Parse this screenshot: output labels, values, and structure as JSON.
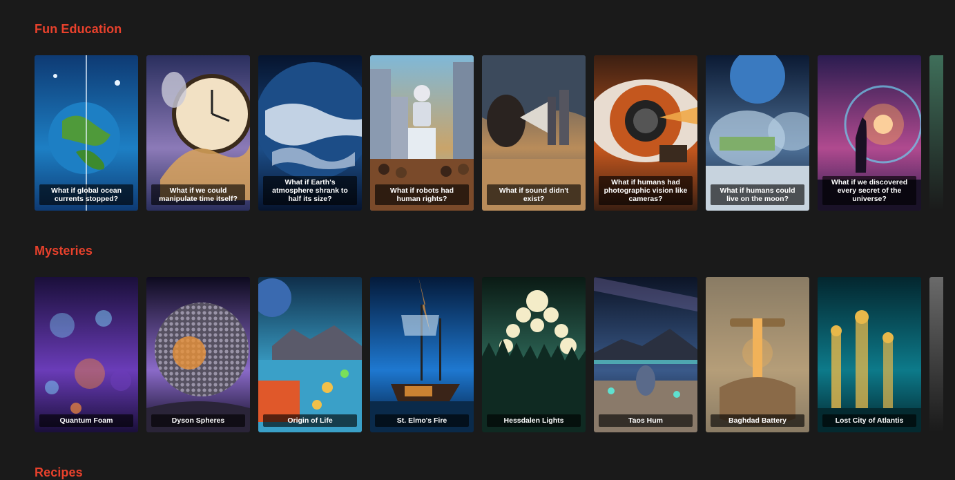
{
  "sections": [
    {
      "title": "Fun Education",
      "cards": [
        {
          "caption": "What if global ocean currents stopped?",
          "art": "earth-ocean",
          "colors": [
            "#0e3a73",
            "#1d7fc4",
            "#6ac6f0",
            "#e8f4ff"
          ]
        },
        {
          "caption": "What if we could manipulate time itself?",
          "art": "clock",
          "colors": [
            "#2a2f5e",
            "#8c7ab8",
            "#d9a35a",
            "#f2e1c4"
          ]
        },
        {
          "caption": "What if Earth's atmosphere shrank to half its size?",
          "art": "earth-clouds",
          "colors": [
            "#06142e",
            "#1c4d87",
            "#5e9bd3",
            "#dfeaf5"
          ]
        },
        {
          "caption": "What if robots had human rights?",
          "art": "robot-podium",
          "colors": [
            "#7fb8d8",
            "#c9a46a",
            "#7a4a2a",
            "#f4e6cf"
          ]
        },
        {
          "caption": "What if sound didn't exist?",
          "art": "megaphone",
          "colors": [
            "#3c4a5c",
            "#b98c5a",
            "#e8c58f",
            "#2a2320"
          ]
        },
        {
          "caption": "What if humans had photographic vision like cameras?",
          "art": "eye-lens",
          "colors": [
            "#3b1f12",
            "#c4571e",
            "#f0a848",
            "#1c2a3a"
          ]
        },
        {
          "caption": "What if humans could live on the moon?",
          "art": "moon-domes",
          "colors": [
            "#0b1a33",
            "#4d6f96",
            "#c7d3de",
            "#7fae6a"
          ]
        },
        {
          "caption": "What if we discovered every secret of the universe?",
          "art": "universe",
          "colors": [
            "#2a1c4f",
            "#b04a8f",
            "#f7a55a",
            "#6fd0f0"
          ]
        }
      ],
      "peek_color": "#3f6f5a"
    },
    {
      "title": "Mysteries",
      "cards": [
        {
          "caption": "Quantum Foam",
          "art": "bubbles",
          "colors": [
            "#1a0f3a",
            "#6a3cb8",
            "#f28a3c",
            "#7fd7ff"
          ]
        },
        {
          "caption": "Dyson Spheres",
          "art": "sphere",
          "colors": [
            "#0d0a1e",
            "#8a6ac8",
            "#e8923a",
            "#f6e2b4"
          ]
        },
        {
          "caption": "Origin of Life",
          "art": "origin",
          "colors": [
            "#0f2e4a",
            "#3aa0c8",
            "#e0582a",
            "#f2c04a"
          ]
        },
        {
          "caption": "St. Elmo's Fire",
          "art": "ship",
          "colors": [
            "#041a3a",
            "#1e78d0",
            "#7ad6ff",
            "#f09a3a"
          ]
        },
        {
          "caption": "Hessdalen Lights",
          "art": "lights-forest",
          "colors": [
            "#0a1a14",
            "#2f6a5a",
            "#f4ecc8",
            "#8ad0b8"
          ]
        },
        {
          "caption": "Taos Hum",
          "art": "taos",
          "colors": [
            "#0c1426",
            "#3a5a8a",
            "#5fe0d0",
            "#8a7a6a"
          ]
        },
        {
          "caption": "Baghdad Battery",
          "art": "battery",
          "colors": [
            "#2a1f14",
            "#8a6a40",
            "#f2b25a",
            "#d8c9a8"
          ]
        },
        {
          "caption": "Lost City of Atlantis",
          "art": "atlantis",
          "colors": [
            "#03262e",
            "#0d7a8a",
            "#3ad0d8",
            "#e8b84a"
          ]
        }
      ],
      "peek_color": "#6a6a6a"
    },
    {
      "title": "Recipes",
      "cards": []
    }
  ]
}
